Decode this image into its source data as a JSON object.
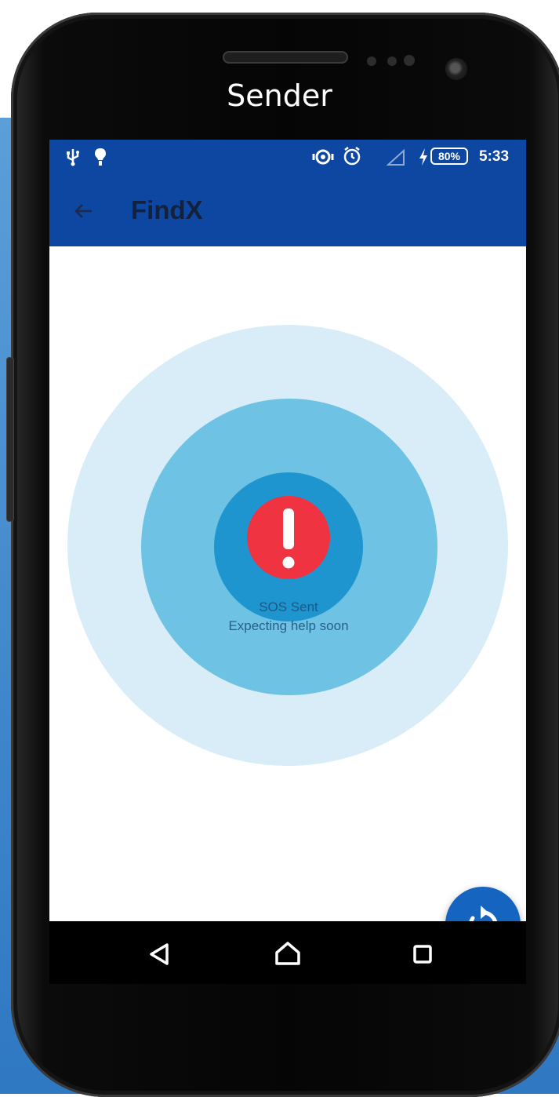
{
  "caption": "Sender",
  "status_bar": {
    "left_icons": [
      "usb-icon",
      "notification-icon"
    ],
    "right_icons": [
      "vibrate-icon",
      "alarm-icon",
      "signal-icon",
      "charging-icon"
    ],
    "battery": "80%",
    "time": "5:33"
  },
  "app_bar": {
    "back_icon": "arrow-left-icon",
    "title": "FindX",
    "color": "#0d47a1"
  },
  "sos": {
    "icon": "exclamation-icon",
    "line1": "SOS Sent",
    "line2": "Expecting help soon",
    "alert_color": "#ef3340"
  },
  "fab": {
    "icon": "refresh-icon",
    "color": "#1565c0"
  },
  "nav_bar": {
    "buttons": [
      "back-triangle-icon",
      "home-icon",
      "recents-icon"
    ]
  }
}
